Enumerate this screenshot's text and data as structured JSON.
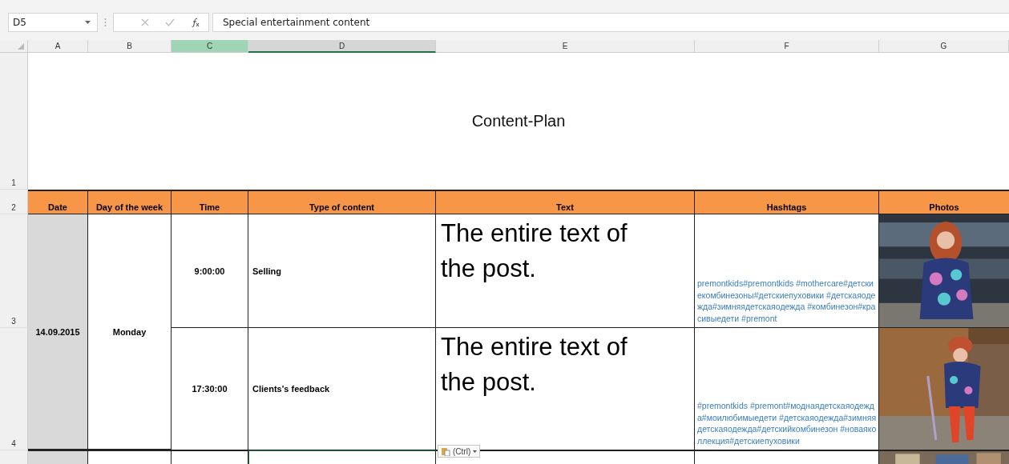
{
  "formula_bar": {
    "name_box": "D5",
    "formula": "Special entertainment content"
  },
  "column_headers": [
    {
      "label": "A",
      "selected": false,
      "highlighted": false
    },
    {
      "label": "B",
      "selected": false,
      "highlighted": false
    },
    {
      "label": "C",
      "selected": false,
      "highlighted": true
    },
    {
      "label": "D",
      "selected": true,
      "highlighted": false
    },
    {
      "label": "E",
      "selected": false,
      "highlighted": false
    },
    {
      "label": "F",
      "selected": false,
      "highlighted": false
    },
    {
      "label": "G",
      "selected": false,
      "highlighted": false
    }
  ],
  "row_headers": [
    "1",
    "2",
    "3",
    "4"
  ],
  "title": "Content-Plan",
  "table_headers": [
    "Date",
    "Day of the week",
    "Time",
    "Type of content",
    "Text",
    "Hashtags",
    "Photos"
  ],
  "day": {
    "date": "14.09.2015",
    "weekday": "Monday",
    "posts": [
      {
        "time": "9:00:00",
        "type": "Selling",
        "text": "The entire text of the post.",
        "hashtags": "premontkids#premontkids #mothercare#детскиекомбинезоны#детскиепуховики #детскаяодежда#зимняядетскаяодежда #комбинезон#красивыедети #premont"
      },
      {
        "time": "17:30:00",
        "type": "Clients's feedback",
        "text": "The entire text of the post.",
        "hashtags": "#premontkids #premont#моднаядетскаяодежда#моилюбимыедети #детскаяодежда#зимняядетскаяодежда#детскийкомбинезон #новаяколлекция#детскиепуховики"
      }
    ]
  },
  "paste_options": {
    "label": "(Ctrl)"
  }
}
